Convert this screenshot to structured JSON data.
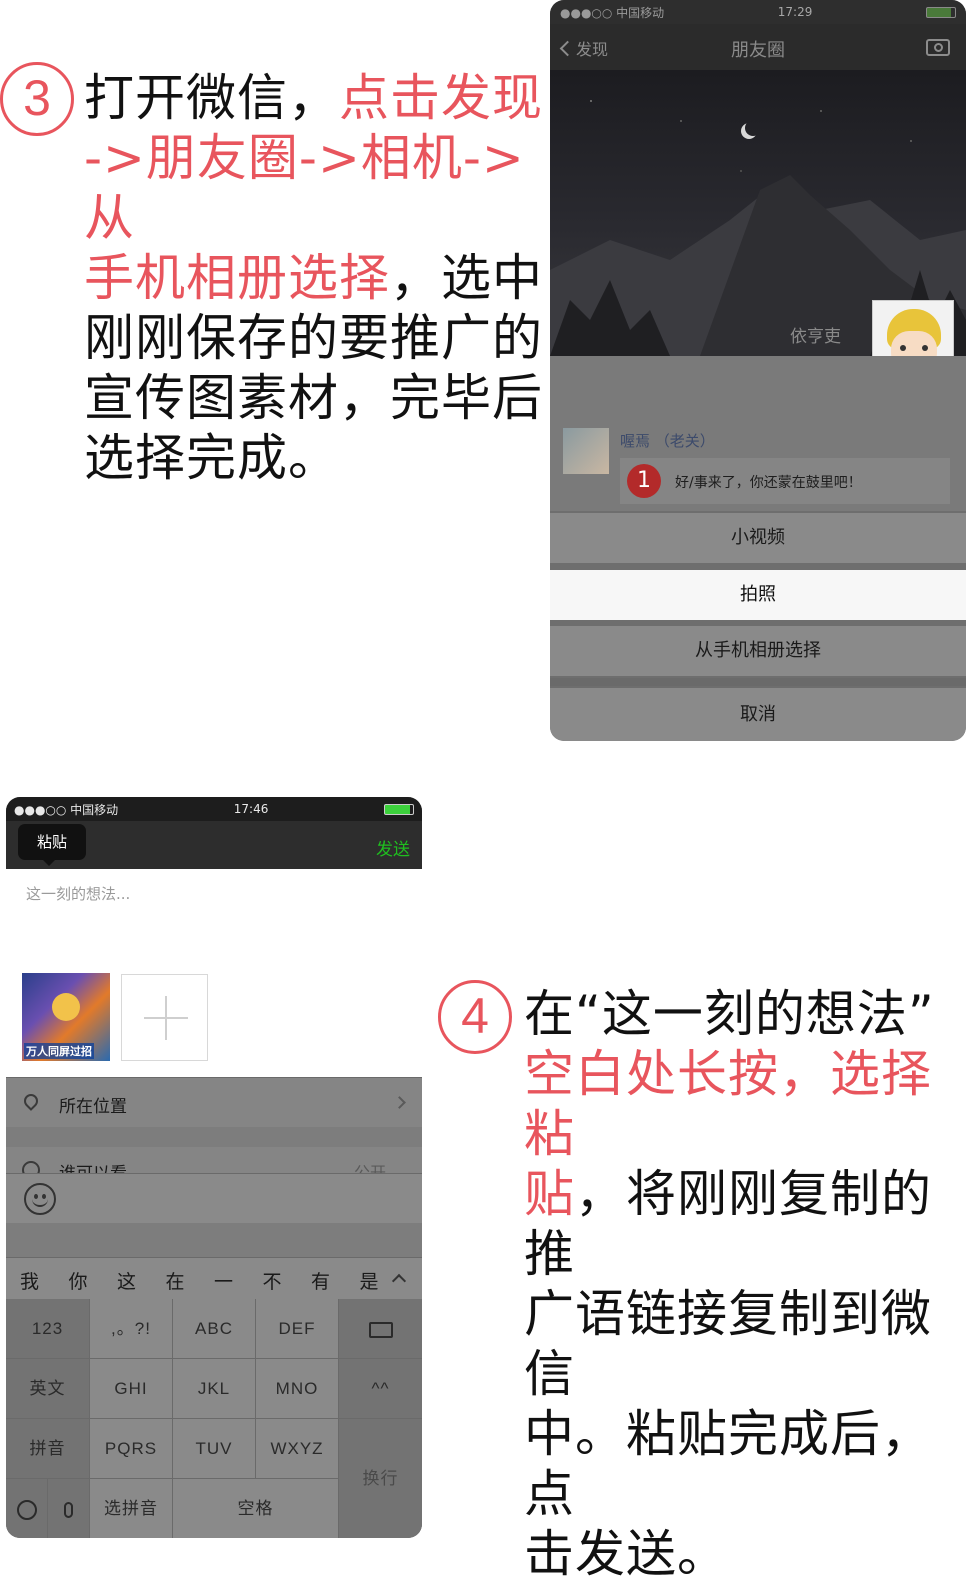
{
  "step3": {
    "number": "3",
    "lines": [
      [
        {
          "t": "打开微信，",
          "red": false
        },
        {
          "t": "点击发现",
          "red": true
        }
      ],
      [
        {
          "t": "->朋友圈->相机->从",
          "red": true
        }
      ],
      [
        {
          "t": "手机相册选择",
          "red": true
        },
        {
          "t": "，选中",
          "red": false
        }
      ],
      [
        {
          "t": "刚刚保存的要推广的",
          "red": false
        }
      ],
      [
        {
          "t": "宣传图素材，完毕后",
          "red": false
        }
      ],
      [
        {
          "t": "选择完成。",
          "red": false
        }
      ]
    ]
  },
  "step4": {
    "number": "4",
    "lines": [
      [
        {
          "t": "在“这一刻的想法”",
          "red": false
        }
      ],
      [
        {
          "t": "空白处长按，选择粘",
          "red": true
        }
      ],
      [
        {
          "t": "贴",
          "red": true
        },
        {
          "t": "，将刚刚复制的推",
          "red": false
        }
      ],
      [
        {
          "t": "广语链接复制到微信",
          "red": false
        }
      ],
      [
        {
          "t": "中。粘贴完成后，点",
          "red": false
        }
      ],
      [
        {
          "t": "击发送。",
          "red": false
        }
      ]
    ]
  },
  "phone1": {
    "status": {
      "carrier": "●●●○○ 中国移动",
      "time": "17:29"
    },
    "nav": {
      "back": "发现",
      "title": "朋友圈"
    },
    "profile_name": "依亨吏",
    "post": {
      "author": "喔焉 （老关）",
      "badge": "1",
      "text": "好/事来了，你还蒙在鼓里吧！"
    },
    "sheet": [
      "小视频",
      "拍照",
      "从手机相册选择",
      "取消"
    ]
  },
  "phone2": {
    "status": {
      "carrier": "●●●○○ 中国移动",
      "time": "17:46"
    },
    "tooltip": "粘贴",
    "send": "发送",
    "placeholder": "这一刻的想法...",
    "image_caption": "万人同屏过招",
    "rows": {
      "location": "所在位置",
      "visibility": "谁可以看",
      "visibility_value": "公开"
    },
    "candidates": [
      "我",
      "你",
      "这",
      "在",
      "一",
      "不",
      "有",
      "是"
    ],
    "keys": {
      "r1": [
        "123",
        ",。?!",
        "ABC",
        "DEF"
      ],
      "r2": [
        "英文",
        "GHI",
        "JKL",
        "MNO",
        "^^"
      ],
      "r3": [
        "拼音",
        "PQRS",
        "TUV",
        "WXYZ"
      ],
      "enter": "换行",
      "select": "选拼音",
      "space": "空格"
    }
  }
}
